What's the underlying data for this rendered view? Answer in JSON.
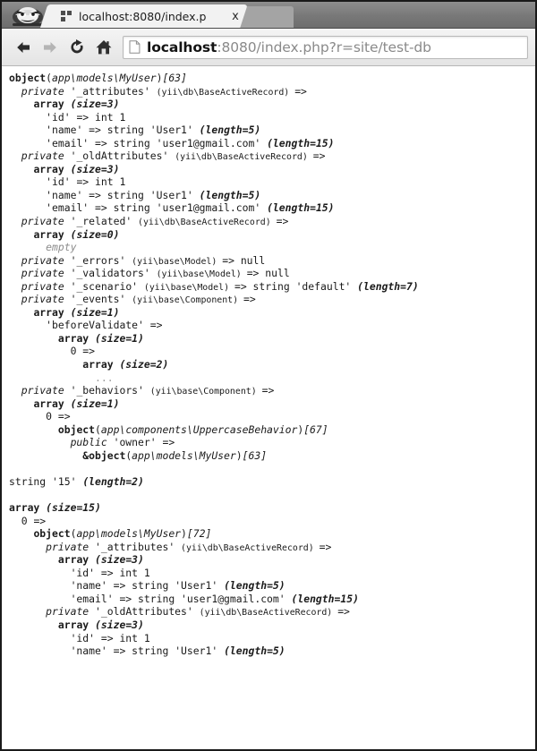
{
  "browser": {
    "logo_icon": "chromium-mascot-logo",
    "tab": {
      "favicon": "generic-page-favicon",
      "title": "localhost:8080/index.p",
      "close_label": "x"
    },
    "toolbar": {
      "back_icon": "back-arrow-icon",
      "forward_icon": "forward-arrow-icon",
      "reload_icon": "reload-icon",
      "home_icon": "home-icon",
      "page_icon": "page-document-icon",
      "url_host": "localhost",
      "url_rest": ":8080/index.php?r=site/test-db",
      "url_full": "localhost:8080/index.php?r=site/test-db"
    }
  },
  "dump": {
    "lines": [
      {
        "indent": 0,
        "tokens": [
          {
            "t": "object",
            "c": "t-type"
          },
          {
            "t": "(",
            "c": "t-plain"
          },
          {
            "t": "app\\models\\MyUser",
            "c": "t-cls"
          },
          {
            "t": ")",
            "c": "t-plain"
          },
          {
            "t": "[63]",
            "c": "t-id"
          }
        ]
      },
      {
        "indent": 1,
        "tokens": [
          {
            "t": "private ",
            "c": "t-mod"
          },
          {
            "t": "'_attributes' ",
            "c": "t-prop"
          },
          {
            "t": "(yii\\db\\BaseActiveRecord) ",
            "c": "t-decl"
          },
          {
            "t": "=>",
            "c": "t-arrow"
          }
        ]
      },
      {
        "indent": 2,
        "tokens": [
          {
            "t": "array ",
            "c": "t-type"
          },
          {
            "t": "(size=3)",
            "c": "t-meta"
          }
        ]
      },
      {
        "indent": 3,
        "tokens": [
          {
            "t": "'id' ",
            "c": "t-prop"
          },
          {
            "t": "=> ",
            "c": "t-arrow"
          },
          {
            "t": "int ",
            "c": "t-plain"
          },
          {
            "t": "1",
            "c": "t-plain"
          }
        ]
      },
      {
        "indent": 3,
        "tokens": [
          {
            "t": "'name' ",
            "c": "t-prop"
          },
          {
            "t": "=> ",
            "c": "t-arrow"
          },
          {
            "t": "string ",
            "c": "t-plain"
          },
          {
            "t": "'User1' ",
            "c": "t-plain"
          },
          {
            "t": "(length=5)",
            "c": "t-meta"
          }
        ]
      },
      {
        "indent": 3,
        "tokens": [
          {
            "t": "'email' ",
            "c": "t-prop"
          },
          {
            "t": "=> ",
            "c": "t-arrow"
          },
          {
            "t": "string ",
            "c": "t-plain"
          },
          {
            "t": "'user1@gmail.com' ",
            "c": "t-plain"
          },
          {
            "t": "(length=15)",
            "c": "t-meta"
          }
        ]
      },
      {
        "indent": 1,
        "tokens": [
          {
            "t": "private ",
            "c": "t-mod"
          },
          {
            "t": "'_oldAttributes' ",
            "c": "t-prop"
          },
          {
            "t": "(yii\\db\\BaseActiveRecord) ",
            "c": "t-decl"
          },
          {
            "t": "=>",
            "c": "t-arrow"
          }
        ]
      },
      {
        "indent": 2,
        "tokens": [
          {
            "t": "array ",
            "c": "t-type"
          },
          {
            "t": "(size=3)",
            "c": "t-meta"
          }
        ]
      },
      {
        "indent": 3,
        "tokens": [
          {
            "t": "'id' ",
            "c": "t-prop"
          },
          {
            "t": "=> ",
            "c": "t-arrow"
          },
          {
            "t": "int ",
            "c": "t-plain"
          },
          {
            "t": "1",
            "c": "t-plain"
          }
        ]
      },
      {
        "indent": 3,
        "tokens": [
          {
            "t": "'name' ",
            "c": "t-prop"
          },
          {
            "t": "=> ",
            "c": "t-arrow"
          },
          {
            "t": "string ",
            "c": "t-plain"
          },
          {
            "t": "'User1' ",
            "c": "t-plain"
          },
          {
            "t": "(length=5)",
            "c": "t-meta"
          }
        ]
      },
      {
        "indent": 3,
        "tokens": [
          {
            "t": "'email' ",
            "c": "t-prop"
          },
          {
            "t": "=> ",
            "c": "t-arrow"
          },
          {
            "t": "string ",
            "c": "t-plain"
          },
          {
            "t": "'user1@gmail.com' ",
            "c": "t-plain"
          },
          {
            "t": "(length=15)",
            "c": "t-meta"
          }
        ]
      },
      {
        "indent": 1,
        "tokens": [
          {
            "t": "private ",
            "c": "t-mod"
          },
          {
            "t": "'_related' ",
            "c": "t-prop"
          },
          {
            "t": "(yii\\db\\BaseActiveRecord) ",
            "c": "t-decl"
          },
          {
            "t": "=>",
            "c": "t-arrow"
          }
        ]
      },
      {
        "indent": 2,
        "tokens": [
          {
            "t": "array ",
            "c": "t-type"
          },
          {
            "t": "(size=0)",
            "c": "t-meta"
          }
        ]
      },
      {
        "indent": 3,
        "tokens": [
          {
            "t": "empty",
            "c": "t-dim"
          }
        ]
      },
      {
        "indent": 1,
        "tokens": [
          {
            "t": "private ",
            "c": "t-mod"
          },
          {
            "t": "'_errors' ",
            "c": "t-prop"
          },
          {
            "t": "(yii\\base\\Model) ",
            "c": "t-decl"
          },
          {
            "t": "=> ",
            "c": "t-arrow"
          },
          {
            "t": "null",
            "c": "t-plain"
          }
        ]
      },
      {
        "indent": 1,
        "tokens": [
          {
            "t": "private ",
            "c": "t-mod"
          },
          {
            "t": "'_validators' ",
            "c": "t-prop"
          },
          {
            "t": "(yii\\base\\Model) ",
            "c": "t-decl"
          },
          {
            "t": "=> ",
            "c": "t-arrow"
          },
          {
            "t": "null",
            "c": "t-plain"
          }
        ]
      },
      {
        "indent": 1,
        "tokens": [
          {
            "t": "private ",
            "c": "t-mod"
          },
          {
            "t": "'_scenario' ",
            "c": "t-prop"
          },
          {
            "t": "(yii\\base\\Model) ",
            "c": "t-decl"
          },
          {
            "t": "=> ",
            "c": "t-arrow"
          },
          {
            "t": "string ",
            "c": "t-plain"
          },
          {
            "t": "'default' ",
            "c": "t-plain"
          },
          {
            "t": "(length=7)",
            "c": "t-meta"
          }
        ]
      },
      {
        "indent": 1,
        "tokens": [
          {
            "t": "private ",
            "c": "t-mod"
          },
          {
            "t": "'_events' ",
            "c": "t-prop"
          },
          {
            "t": "(yii\\base\\Component) ",
            "c": "t-decl"
          },
          {
            "t": "=>",
            "c": "t-arrow"
          }
        ]
      },
      {
        "indent": 2,
        "tokens": [
          {
            "t": "array ",
            "c": "t-type"
          },
          {
            "t": "(size=1)",
            "c": "t-meta"
          }
        ]
      },
      {
        "indent": 3,
        "tokens": [
          {
            "t": "'beforeValidate' ",
            "c": "t-prop"
          },
          {
            "t": "=>",
            "c": "t-arrow"
          }
        ]
      },
      {
        "indent": 4,
        "tokens": [
          {
            "t": "array ",
            "c": "t-type"
          },
          {
            "t": "(size=1)",
            "c": "t-meta"
          }
        ]
      },
      {
        "indent": 5,
        "tokens": [
          {
            "t": "0 ",
            "c": "t-plain"
          },
          {
            "t": "=>",
            "c": "t-arrow"
          }
        ]
      },
      {
        "indent": 6,
        "tokens": [
          {
            "t": "array ",
            "c": "t-type"
          },
          {
            "t": "(size=2)",
            "c": "t-meta"
          }
        ]
      },
      {
        "indent": 7,
        "tokens": [
          {
            "t": "...",
            "c": "t-dots"
          }
        ]
      },
      {
        "indent": 1,
        "tokens": [
          {
            "t": "private ",
            "c": "t-mod"
          },
          {
            "t": "'_behaviors' ",
            "c": "t-prop"
          },
          {
            "t": "(yii\\base\\Component) ",
            "c": "t-decl"
          },
          {
            "t": "=>",
            "c": "t-arrow"
          }
        ]
      },
      {
        "indent": 2,
        "tokens": [
          {
            "t": "array ",
            "c": "t-type"
          },
          {
            "t": "(size=1)",
            "c": "t-meta"
          }
        ]
      },
      {
        "indent": 3,
        "tokens": [
          {
            "t": "0 ",
            "c": "t-plain"
          },
          {
            "t": "=>",
            "c": "t-arrow"
          }
        ]
      },
      {
        "indent": 4,
        "tokens": [
          {
            "t": "object",
            "c": "t-type"
          },
          {
            "t": "(",
            "c": "t-plain"
          },
          {
            "t": "app\\components\\UppercaseBehavior",
            "c": "t-cls"
          },
          {
            "t": ")",
            "c": "t-plain"
          },
          {
            "t": "[67]",
            "c": "t-id"
          }
        ]
      },
      {
        "indent": 5,
        "tokens": [
          {
            "t": "public ",
            "c": "t-mod"
          },
          {
            "t": "'owner' ",
            "c": "t-prop"
          },
          {
            "t": "=>",
            "c": "t-arrow"
          }
        ]
      },
      {
        "indent": 6,
        "tokens": [
          {
            "t": "&",
            "c": "t-type"
          },
          {
            "t": "object",
            "c": "t-type"
          },
          {
            "t": "(",
            "c": "t-plain"
          },
          {
            "t": "app\\models\\MyUser",
            "c": "t-cls"
          },
          {
            "t": ")",
            "c": "t-plain"
          },
          {
            "t": "[63]",
            "c": "t-id"
          }
        ]
      },
      {
        "blank": true
      },
      {
        "indent": 0,
        "tokens": [
          {
            "t": "string ",
            "c": "t-plain"
          },
          {
            "t": "'15' ",
            "c": "t-plain"
          },
          {
            "t": "(length=2)",
            "c": "t-meta"
          }
        ]
      },
      {
        "blank": true
      },
      {
        "indent": 0,
        "tokens": [
          {
            "t": "array ",
            "c": "t-type"
          },
          {
            "t": "(size=15)",
            "c": "t-meta"
          }
        ]
      },
      {
        "indent": 1,
        "tokens": [
          {
            "t": "0 ",
            "c": "t-plain"
          },
          {
            "t": "=>",
            "c": "t-arrow"
          }
        ]
      },
      {
        "indent": 2,
        "tokens": [
          {
            "t": "object",
            "c": "t-type"
          },
          {
            "t": "(",
            "c": "t-plain"
          },
          {
            "t": "app\\models\\MyUser",
            "c": "t-cls"
          },
          {
            "t": ")",
            "c": "t-plain"
          },
          {
            "t": "[72]",
            "c": "t-id"
          }
        ]
      },
      {
        "indent": 3,
        "tokens": [
          {
            "t": "private ",
            "c": "t-mod"
          },
          {
            "t": "'_attributes' ",
            "c": "t-prop"
          },
          {
            "t": "(yii\\db\\BaseActiveRecord) ",
            "c": "t-decl"
          },
          {
            "t": "=>",
            "c": "t-arrow"
          }
        ]
      },
      {
        "indent": 4,
        "tokens": [
          {
            "t": "array ",
            "c": "t-type"
          },
          {
            "t": "(size=3)",
            "c": "t-meta"
          }
        ]
      },
      {
        "indent": 5,
        "tokens": [
          {
            "t": "'id' ",
            "c": "t-prop"
          },
          {
            "t": "=> ",
            "c": "t-arrow"
          },
          {
            "t": "int ",
            "c": "t-plain"
          },
          {
            "t": "1",
            "c": "t-plain"
          }
        ]
      },
      {
        "indent": 5,
        "tokens": [
          {
            "t": "'name' ",
            "c": "t-prop"
          },
          {
            "t": "=> ",
            "c": "t-arrow"
          },
          {
            "t": "string ",
            "c": "t-plain"
          },
          {
            "t": "'User1' ",
            "c": "t-plain"
          },
          {
            "t": "(length=5)",
            "c": "t-meta"
          }
        ]
      },
      {
        "indent": 5,
        "tokens": [
          {
            "t": "'email' ",
            "c": "t-prop"
          },
          {
            "t": "=> ",
            "c": "t-arrow"
          },
          {
            "t": "string ",
            "c": "t-plain"
          },
          {
            "t": "'user1@gmail.com' ",
            "c": "t-plain"
          },
          {
            "t": "(length=15)",
            "c": "t-meta"
          }
        ]
      },
      {
        "indent": 3,
        "tokens": [
          {
            "t": "private ",
            "c": "t-mod"
          },
          {
            "t": "'_oldAttributes' ",
            "c": "t-prop"
          },
          {
            "t": "(yii\\db\\BaseActiveRecord) ",
            "c": "t-decl"
          },
          {
            "t": "=>",
            "c": "t-arrow"
          }
        ]
      },
      {
        "indent": 4,
        "tokens": [
          {
            "t": "array ",
            "c": "t-type"
          },
          {
            "t": "(size=3)",
            "c": "t-meta"
          }
        ]
      },
      {
        "indent": 5,
        "tokens": [
          {
            "t": "'id' ",
            "c": "t-prop"
          },
          {
            "t": "=> ",
            "c": "t-arrow"
          },
          {
            "t": "int ",
            "c": "t-plain"
          },
          {
            "t": "1",
            "c": "t-plain"
          }
        ]
      },
      {
        "indent": 5,
        "tokens": [
          {
            "t": "'name' ",
            "c": "t-prop"
          },
          {
            "t": "=> ",
            "c": "t-arrow"
          },
          {
            "t": "string ",
            "c": "t-plain"
          },
          {
            "t": "'User1' ",
            "c": "t-plain"
          },
          {
            "t": "(length=5)",
            "c": "t-meta"
          }
        ]
      }
    ]
  }
}
